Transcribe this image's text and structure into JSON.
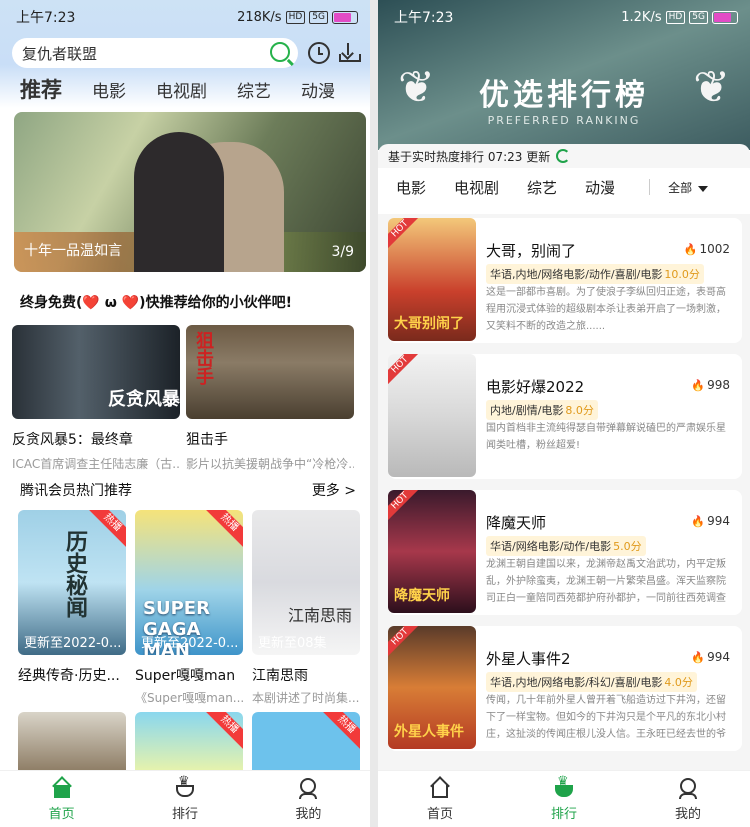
{
  "left": {
    "status": {
      "time": "上午7:23",
      "speed": "218K/s",
      "battery": "99"
    },
    "search": {
      "value": "复仇者联盟"
    },
    "tabs": [
      "推荐",
      "电影",
      "电视剧",
      "综艺",
      "动漫"
    ],
    "banner": {
      "caption": "十年一品温如言",
      "index": "3/9"
    },
    "free_title": "终身免费(❤️ ω ❤️)快推荐给你的小伙伴吧!",
    "wide_cards": [
      {
        "title": "反贪风暴5：最终章",
        "subtitle": "ICAC首席调查主任陆志廉（古...",
        "poster_text": "反贪风暴"
      },
      {
        "title": "狙击手",
        "subtitle": "影片以抗美援朝战争中“冷枪冷...",
        "poster_text": "狙击手"
      }
    ],
    "section": {
      "title": "腾讯会员热门推荐",
      "more": "更多 >"
    },
    "vcards": [
      {
        "tag": "热播",
        "update": "更新至2022-0...",
        "title": "经典传奇·历史...",
        "subtitle": "",
        "poster_text": "历史秘闻"
      },
      {
        "tag": "热播",
        "update": "更新至2022-0...",
        "title": "Super嘎嘎man",
        "subtitle": "《Super嘎嘎man...",
        "poster_text": "SUPER GAGA MAN"
      },
      {
        "tag": "",
        "update": "更新至08集",
        "title": "江南思雨",
        "subtitle": "本剧讲述了时尚集...",
        "poster_text": "江南思雨"
      }
    ],
    "vcards2": [
      {
        "tag": ""
      },
      {
        "tag": "热播"
      },
      {
        "tag": "热播"
      }
    ],
    "bottom_tabs": [
      "首页",
      "排行",
      "我的"
    ]
  },
  "right": {
    "status": {
      "time": "上午7:23",
      "speed": "1.2K/s",
      "battery": "99"
    },
    "hero_title": "优选排行榜",
    "hero_sub": "PREFERRED RANKING",
    "update_line": "基于实时热度排行 07:23 更新",
    "tabs": [
      "电影",
      "电视剧",
      "综艺",
      "动漫"
    ],
    "all": "全部",
    "items": [
      {
        "name": "大哥，别闹了",
        "heat": "1002",
        "genre": "华语,内地/网络电影/动作/喜剧/电影",
        "score": "10.0分",
        "desc": "这是一部都市喜剧。为了使浪子李纵回归正途，表哥高程用沉浸式体验的超级剧本杀让表弟开启了一场刺激，又笑料不断的改造之旅......",
        "hot": "HOT",
        "poster_text": "大哥别闹了"
      },
      {
        "name": "电影好爆2022",
        "heat": "998",
        "genre": "内地/剧情/电影",
        "score": "8.0分",
        "desc": "国内首档非主流纯得瑟自带弹幕解说磕巴的严肃娱乐星闻类吐槽，粉丝超爱!",
        "hot": "HOT",
        "poster_text": ""
      },
      {
        "name": "降魔天师",
        "heat": "994",
        "genre": "华语/网络电影/动作/电影",
        "score": "5.0分",
        "desc": "龙渊王朝自建国以来，龙渊帝赵禹文治武功，内平定叛乱，外护除蛮夷，龙渊王朝一片繁荣昌盛。浑天监察院司正白一童陪同西苑都护府孙都护，一同前往西苑调查蝗......",
        "hot": "HOT",
        "poster_text": "降魔天师"
      },
      {
        "name": "外星人事件2",
        "heat": "994",
        "genre": "华语,内地/网络电影/科幻/喜剧/电影",
        "score": "4.0分",
        "desc": "传闻，几十年前外星人曾开着飞船造访过下井沟，还留下了一样宝物。但如今的下井沟只是个平凡的东北小村庄，这扯淡的传闻庄根儿没人信。王永旺已经去世的爷爷就......",
        "hot": "HOT",
        "poster_text": "外星人事件"
      }
    ],
    "bottom_tabs": [
      "首页",
      "排行",
      "我的"
    ]
  }
}
